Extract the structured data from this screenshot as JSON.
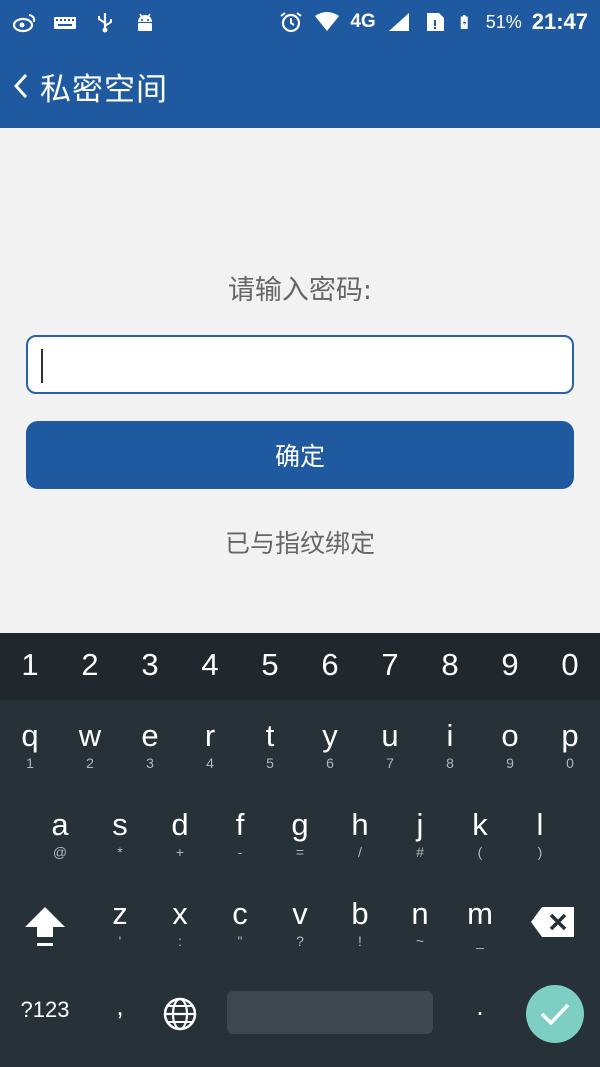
{
  "status_bar": {
    "icons_left": [
      "weibo-icon",
      "keyboard-icon",
      "usb-icon",
      "android-icon"
    ],
    "icons_right": [
      "alarm-icon",
      "wifi-icon",
      "signal-icon",
      "sim-icon",
      "battery-icon"
    ],
    "network": "4G",
    "battery": "51%",
    "time": "21:47"
  },
  "app_bar": {
    "title": "私密空间",
    "back_icon": "chevron-left-icon"
  },
  "content": {
    "prompt": "请输入密码:",
    "password_value": "",
    "confirm_label": "确定",
    "fingerprint_note": "已与指纹绑定"
  },
  "keyboard": {
    "numbers": [
      "1",
      "2",
      "3",
      "4",
      "5",
      "6",
      "7",
      "8",
      "9",
      "0"
    ],
    "row1": [
      {
        "key": "q",
        "hint": "1"
      },
      {
        "key": "w",
        "hint": "2"
      },
      {
        "key": "e",
        "hint": "3"
      },
      {
        "key": "r",
        "hint": "4"
      },
      {
        "key": "t",
        "hint": "5"
      },
      {
        "key": "y",
        "hint": "6"
      },
      {
        "key": "u",
        "hint": "7"
      },
      {
        "key": "i",
        "hint": "8"
      },
      {
        "key": "o",
        "hint": "9"
      },
      {
        "key": "p",
        "hint": "0"
      }
    ],
    "row2": [
      {
        "key": "a",
        "hint": "@"
      },
      {
        "key": "s",
        "hint": "*"
      },
      {
        "key": "d",
        "hint": "+"
      },
      {
        "key": "f",
        "hint": "-"
      },
      {
        "key": "g",
        "hint": "="
      },
      {
        "key": "h",
        "hint": "/"
      },
      {
        "key": "j",
        "hint": "#"
      },
      {
        "key": "k",
        "hint": "("
      },
      {
        "key": "l",
        "hint": ")"
      }
    ],
    "row3": [
      {
        "key": "z",
        "hint": "'"
      },
      {
        "key": "x",
        "hint": ":"
      },
      {
        "key": "c",
        "hint": "\""
      },
      {
        "key": "v",
        "hint": "?"
      },
      {
        "key": "b",
        "hint": "!"
      },
      {
        "key": "n",
        "hint": "~"
      },
      {
        "key": "m",
        "hint": "_"
      }
    ],
    "symbols_label": "?123",
    "comma": ",",
    "period": ".",
    "colors": {
      "enter": "#7dcfc3",
      "background": "#263238"
    }
  },
  "colors": {
    "primary": "#1f5aa0",
    "background": "#f2f2f2"
  }
}
